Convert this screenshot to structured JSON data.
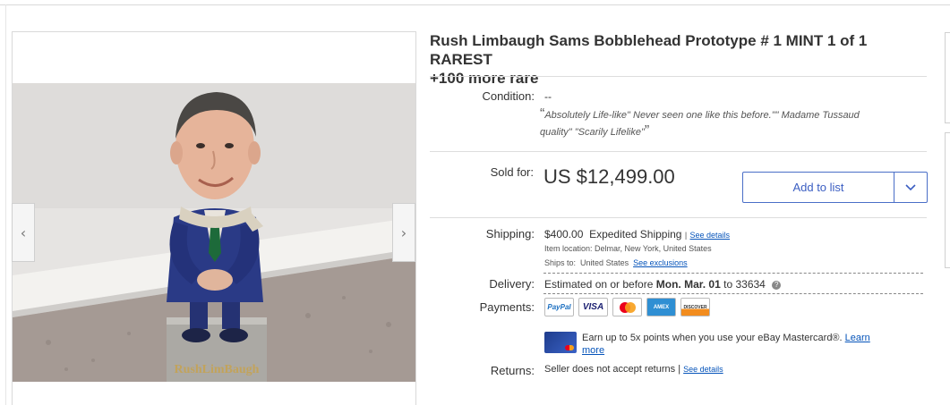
{
  "listing": {
    "title_line1": "Rush Limbaugh Sams Bobblehead Prototype # 1 MINT 1 of 1 RAREST",
    "title_line2": "+100 more rare"
  },
  "image_nav": {
    "prev_glyph": "‹",
    "next_glyph": "›"
  },
  "base_text": "RushLimBaugh",
  "condition": {
    "label": "Condition:",
    "value": "--",
    "quote_open": "“",
    "quote_line1": "Absolutely Life-like\" Never seen one like this before.\"\" Madame Tussaud",
    "quote_line2": "quality\" \"Scarily Lifelike\"",
    "quote_close": "”"
  },
  "sold": {
    "label": "Sold for:",
    "price": "US $12,499.00",
    "add_to_list": "Add to list"
  },
  "shipping": {
    "label": "Shipping:",
    "cost": "$400.00",
    "method": "Expedited Shipping",
    "separator": "|",
    "see_details": "See details",
    "item_location_label": "Item location:",
    "item_location": "Delmar, New York, United States",
    "ships_to_label": "Ships to:",
    "ships_to": "United States",
    "see_exclusions": "See exclusions"
  },
  "delivery": {
    "label": "Delivery:",
    "prefix": "Estimated on or before",
    "date": "Mon. Mar. 01",
    "to": "to",
    "zip": "33634",
    "info_glyph": "?"
  },
  "payments": {
    "label": "Payments:",
    "methods": [
      "PayPal",
      "VISA",
      "Mastercard",
      "AMEX",
      "DISCOVER"
    ]
  },
  "promo": {
    "text": "Earn up to 5x points when you use your eBay Mastercard®.",
    "link_part1": "Learn",
    "link_part2": "more"
  },
  "returns": {
    "label": "Returns:",
    "text": "Seller does not accept returns",
    "separator": "|",
    "see_details": "See details"
  },
  "colors": {
    "link": "#0654ba",
    "button_border": "#4a6ec7",
    "suit": "#27357a",
    "wall": "#e8e6e4"
  }
}
